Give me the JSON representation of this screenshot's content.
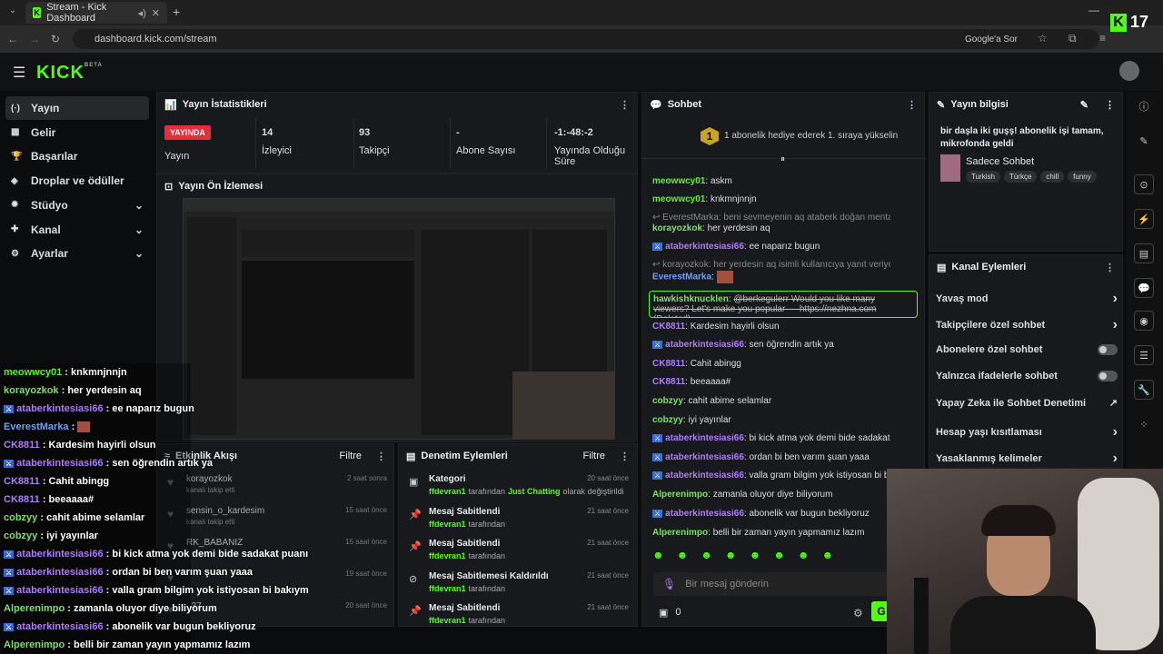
{
  "browser": {
    "tab_title": "Stream - Kick Dashboard",
    "url": "dashboard.kick.com/stream",
    "google_button": "Google'a Sor",
    "overlay_viewers": "17"
  },
  "app": {
    "logo": "KICK",
    "logo_badge": "BETA"
  },
  "sidebar": {
    "items": [
      {
        "label": "Yayın",
        "icon": "broadcast-icon"
      },
      {
        "label": "Gelir",
        "icon": "income-icon"
      },
      {
        "label": "Başarılar",
        "icon": "trophy-icon"
      },
      {
        "label": "Droplar ve ödüller",
        "icon": "drops-icon"
      },
      {
        "label": "Stüdyo",
        "icon": "studio-icon"
      },
      {
        "label": "Kanal",
        "icon": "channel-icon"
      },
      {
        "label": "Ayarlar",
        "icon": "settings-icon"
      }
    ]
  },
  "stats": {
    "title": "Yayın İstatistikleri",
    "live_badge": "YAYINDA",
    "live_label": "Yayın",
    "viewers_value": "14",
    "viewers_label": "İzleyici",
    "followers_value": "93",
    "followers_label": "Takipçi",
    "subs_value": "-",
    "subs_label": "Abone Sayısı",
    "duration_value": "-1:-48:-2",
    "duration_label": "Yayında Olduğu Süre"
  },
  "preview": {
    "title": "Yayın Ön İzlemesi"
  },
  "activity": {
    "title": "Etkinlik Akışı",
    "filter": "Filtre",
    "items": [
      {
        "user": "korayozkok",
        "desc": "kanalı takip etti",
        "time": "2 saat sonra"
      },
      {
        "user": "sensin_o_kardesim",
        "desc": "kanalı takip etti",
        "time": "15 saat önce"
      },
      {
        "user": "RK_BABANIZ",
        "desc": "",
        "time": "15 saat önce"
      },
      {
        "user": "",
        "desc": "",
        "time": "19 saat önce"
      },
      {
        "user": "_37",
        "desc": "",
        "time": "20 saat önce"
      }
    ]
  },
  "moderation": {
    "title": "Denetim Eylemleri",
    "filter": "Filtre",
    "items": [
      {
        "title": "Kategori",
        "actor": "ffdevran1",
        "mid": "tarafından",
        "extra": "Just Chatting",
        "tail": "olarak değiştirildi",
        "time": "20 saat önce"
      },
      {
        "title": "Mesaj Sabitlendi",
        "actor": "ffdevran1",
        "mid": "tarafından",
        "extra": "",
        "tail": "",
        "time": "21 saat önce"
      },
      {
        "title": "Mesaj Sabitlendi",
        "actor": "ffdevran1",
        "mid": "tarafından",
        "extra": "",
        "tail": "",
        "time": "21 saat önce"
      },
      {
        "title": "Mesaj Sabitlemesi Kaldırıldı",
        "actor": "ffdevran1",
        "mid": "tarafından",
        "extra": "",
        "tail": "",
        "time": "21 saat önce"
      },
      {
        "title": "Mesaj Sabitlendi",
        "actor": "ffdevran1",
        "mid": "tarafından",
        "extra": "",
        "tail": "",
        "time": "21 saat önce"
      }
    ]
  },
  "chat": {
    "title": "Sohbet",
    "gift_rank": "1",
    "gift_text": "1 abonelik hediye ederek 1. sıraya yükselin",
    "input_placeholder": "Bir mesaj gönderin",
    "points": "0",
    "send": "G",
    "messages": [
      {
        "user": "meowwcy01",
        "sep": ": ",
        "text": "askm",
        "color": "u-green",
        "badge": false
      },
      {
        "user": "meowwcy01",
        "sep": ": ",
        "text": "knkmnjnnjn",
        "color": "u-green",
        "badge": false
      },
      {
        "user": "",
        "sep": "",
        "text": "↩ EverestMarka: beni sevmeyenin aq ataberk doğan mentality isimli kull...",
        "color": "u-gray",
        "badge": false
      },
      {
        "user": "korayozkok",
        "sep": ": ",
        "text": "her yerdesin aq",
        "color": "u-lime",
        "badge": false
      },
      {
        "user": "ataberkintesiasi66",
        "sep": ": ",
        "text": "ee naparız bugun",
        "color": "u-purple",
        "badge": true
      },
      {
        "user": "",
        "sep": "",
        "text": "↩ korayozkok: her yerdesin aq isimli kullanıcıya yanıt veriyor",
        "color": "u-gray",
        "badge": false
      },
      {
        "user": "EverestMarka",
        "sep": ": ",
        "text": "",
        "color": "u-blue",
        "badge": false
      },
      {
        "user": "hawkishknucklen",
        "sep": ": ",
        "text": "@berkegulerr Would you like many viewers? Let's make you popular — https://nezhna.com (Deleted)",
        "color": "u-lime",
        "badge": false
      },
      {
        "user": "CK8811",
        "sep": ": ",
        "text": "Kardesim hayirli olsun",
        "color": "u-purple",
        "badge": false
      },
      {
        "user": "ataberkintesiasi66",
        "sep": ": ",
        "text": "sen öğrendin artık ya",
        "color": "u-purple",
        "badge": true
      },
      {
        "user": "CK8811",
        "sep": ": ",
        "text": "Cahit abingg",
        "color": "u-purple",
        "badge": false
      },
      {
        "user": "CK8811",
        "sep": ": ",
        "text": "beeaaaa#",
        "color": "u-purple",
        "badge": false
      },
      {
        "user": "cobzyy",
        "sep": ": ",
        "text": "cahit abime selamlar",
        "color": "u-lime",
        "badge": false
      },
      {
        "user": "cobzyy",
        "sep": ": ",
        "text": "iyi yayınlar",
        "color": "u-lime",
        "badge": false
      },
      {
        "user": "ataberkintesiasi66",
        "sep": ": ",
        "text": "bi kick atma yok demi bide sadakat puanı",
        "color": "u-purple",
        "badge": true
      },
      {
        "user": "ataberkintesiasi66",
        "sep": ": ",
        "text": "ordan bi ben varım şuan yaaa",
        "color": "u-purple",
        "badge": true
      },
      {
        "user": "ataberkintesiasi66",
        "sep": ": ",
        "text": "valla gram bilgim yok istiyosan bi bakıym",
        "color": "u-purple",
        "badge": true
      },
      {
        "user": "Alperenimpo",
        "sep": ": ",
        "text": "zamanla oluyor diye biliyorum",
        "color": "u-lime",
        "badge": false
      },
      {
        "user": "ataberkintesiasi66",
        "sep": ": ",
        "text": "abonelik var bugun bekliyoruz",
        "color": "u-purple",
        "badge": true
      },
      {
        "user": "Alperenimpo",
        "sep": ": ",
        "text": "belli bir zaman yayın yapmamız lazım",
        "color": "u-lime",
        "badge": false
      }
    ]
  },
  "stream_info": {
    "title": "Yayın bilgisi",
    "stream_title": "bir daşla iki guşş! abonelik işi tamam, mikrofonda geldi",
    "category": "Sadece Sohbet",
    "tags": [
      "Turkish",
      "Türkçe",
      "chill",
      "funny"
    ]
  },
  "channel_actions": {
    "title": "Kanal Eylemleri",
    "items": [
      {
        "label": "Yavaş mod",
        "kind": "chevron"
      },
      {
        "label": "Takipçilere özel sohbet",
        "kind": "chevron"
      },
      {
        "label": "Abonelere özel sohbet",
        "kind": "toggle"
      },
      {
        "label": "Yalnızca ifadelerle sohbet",
        "kind": "toggle"
      },
      {
        "label": "Yapay Zeka ile Sohbet Denetimi",
        "kind": "external"
      },
      {
        "label": "Hesap yaşı kısıtlaması",
        "kind": "chevron"
      },
      {
        "label": "Yasaklanmış kelimeler",
        "kind": "chevron"
      }
    ]
  },
  "overlay_chat": [
    {
      "user": "meowwcy01",
      "text": "knkmnjnnjn",
      "color": "u-green",
      "badge": false
    },
    {
      "user": "korayozkok",
      "text": "her yerdesin aq",
      "color": "u-lime",
      "badge": false
    },
    {
      "user": "ataberkintesiasi66",
      "text": "ee naparız bugun",
      "color": "u-purple",
      "badge": true
    },
    {
      "user": "EverestMarka",
      "text": "",
      "color": "u-blue",
      "badge": false
    },
    {
      "user": "CK8811",
      "text": "Kardesim hayirli olsun",
      "color": "u-purple",
      "badge": false
    },
    {
      "user": "ataberkintesiasi66",
      "text": "sen öğrendin artık ya",
      "color": "u-purple",
      "badge": true
    },
    {
      "user": "CK8811",
      "text": "Cahit abingg",
      "color": "u-purple",
      "badge": false
    },
    {
      "user": "CK8811",
      "text": "beeaaaa#",
      "color": "u-purple",
      "badge": false
    },
    {
      "user": "cobzyy",
      "text": "cahit abime selamlar",
      "color": "u-lime",
      "badge": false
    },
    {
      "user": "cobzyy",
      "text": "iyi yayınlar",
      "color": "u-lime",
      "badge": false
    },
    {
      "user": "ataberkintesiasi66",
      "text": "bi kick atma yok demi bide sadakat puanı",
      "color": "u-purple",
      "badge": true
    },
    {
      "user": "ataberkintesiasi66",
      "text": "ordan bi ben varım şuan yaaa",
      "color": "u-purple",
      "badge": true
    },
    {
      "user": "ataberkintesiasi66",
      "text": "valla gram bilgim yok istiyosan bi bakıym",
      "color": "u-purple",
      "badge": true
    },
    {
      "user": "Alperenimpo",
      "text": "zamanla oluyor diye biliyorum",
      "color": "u-lime",
      "badge": false
    },
    {
      "user": "ataberkintesiasi66",
      "text": "abonelik var bugun bekliyoruz",
      "color": "u-purple",
      "badge": true
    },
    {
      "user": "Alperenimpo",
      "text": "belli bir zaman yayın yapmamız lazım",
      "color": "u-lime",
      "badge": false
    }
  ],
  "colors": {
    "brand_green": "#53fc18",
    "live_red": "#e0303a",
    "panel_bg": "#18191c"
  }
}
